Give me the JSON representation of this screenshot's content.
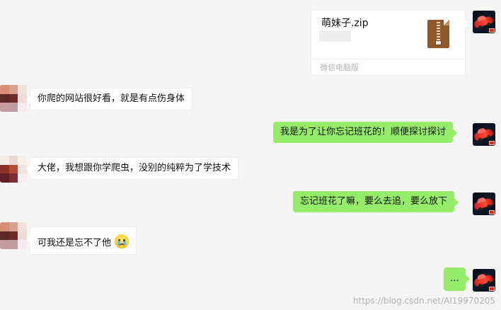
{
  "file_message": {
    "filename": "萌妹子.zip",
    "source": "微信电脑版"
  },
  "messages": [
    {
      "side": "left",
      "text": "你爬的网站很好看，就是有点伤身体"
    },
    {
      "side": "right",
      "text": "我是为了让你忘记班花的！顺便探讨探讨"
    },
    {
      "side": "left",
      "text": "大佬，我想跟你学爬虫，没别的纯粹为了学技术"
    },
    {
      "side": "right",
      "text": "忘记班花了嘛，要么去追，要么放下"
    },
    {
      "side": "left",
      "text": "可我还是忘不了他",
      "emoji": "crying-face-icon"
    },
    {
      "side": "right",
      "text": "..."
    }
  ],
  "watermark": "https://blog.csdn.net/AI19970205",
  "colors": {
    "background": "#f5f5f5",
    "right_bubble": "#95ec69",
    "left_bubble": "#ffffff",
    "file_icon": "#8f5a2b"
  }
}
